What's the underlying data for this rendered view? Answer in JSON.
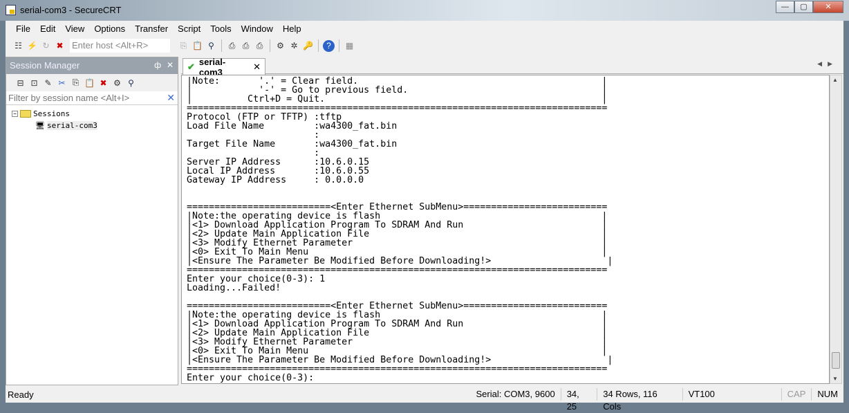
{
  "window": {
    "title": "serial-com3 - SecureCRT",
    "min": "—",
    "max": "▢",
    "close": "✕"
  },
  "menu": [
    "File",
    "Edit",
    "View",
    "Options",
    "Transfer",
    "Script",
    "Tools",
    "Window",
    "Help"
  ],
  "toolbar": {
    "host_placeholder": "Enter host <Alt+R>"
  },
  "session_manager": {
    "title": "Session Manager",
    "pin": "ꟷ",
    "close": "✕",
    "filter_placeholder": "Filter by session name <Alt+I>",
    "filter_clear": "✕",
    "root": "Sessions",
    "item": "serial-com3"
  },
  "tab": {
    "label": "serial-com3",
    "close": "✕",
    "check": "✔"
  },
  "terminal": {
    "lines": [
      "|Note:       '.' = Clear field.                                            |",
      "|            '-' = Go to previous field.                                   |",
      "|          Ctrl+D = Quit.                                                  |",
      "============================================================================",
      "Protocol (FTP or TFTP) :tftp",
      "Load File Name         :wa4300_fat.bin",
      "                       :",
      "Target File Name       :wa4300_fat.bin",
      "                       :",
      "Server IP Address      :10.6.0.15",
      "Local IP Address       :10.6.0.55",
      "Gateway IP Address     : 0.0.0.0",
      "",
      "",
      "==========================<Enter Ethernet SubMenu>==========================",
      "|Note:the operating device is flash                                        |",
      "|<1> Download Application Program To SDRAM And Run                         |",
      "|<2> Update Main Application File                                          |",
      "|<3> Modify Ethernet Parameter                                             |",
      "|<0> Exit To Main Menu                                                     |",
      "|<Ensure The Parameter Be Modified Before Downloading!>                     |",
      "============================================================================",
      "Enter your choice(0-3): 1",
      "Loading...Failed!",
      "",
      "==========================<Enter Ethernet SubMenu>==========================",
      "|Note:the operating device is flash                                        |",
      "|<1> Download Application Program To SDRAM And Run                         |",
      "|<2> Update Main Application File                                          |",
      "|<3> Modify Ethernet Parameter                                             |",
      "|<0> Exit To Main Menu                                                     |",
      "|<Ensure The Parameter Be Modified Before Downloading!>                     |",
      "============================================================================",
      "Enter your choice(0-3):"
    ]
  },
  "status": {
    "ready": "Ready",
    "connection": "Serial: COM3, 9600",
    "cursor": "34,  25",
    "size": "34 Rows, 116 Cols",
    "emulation": "VT100",
    "cap": "CAP",
    "num": "NUM"
  }
}
